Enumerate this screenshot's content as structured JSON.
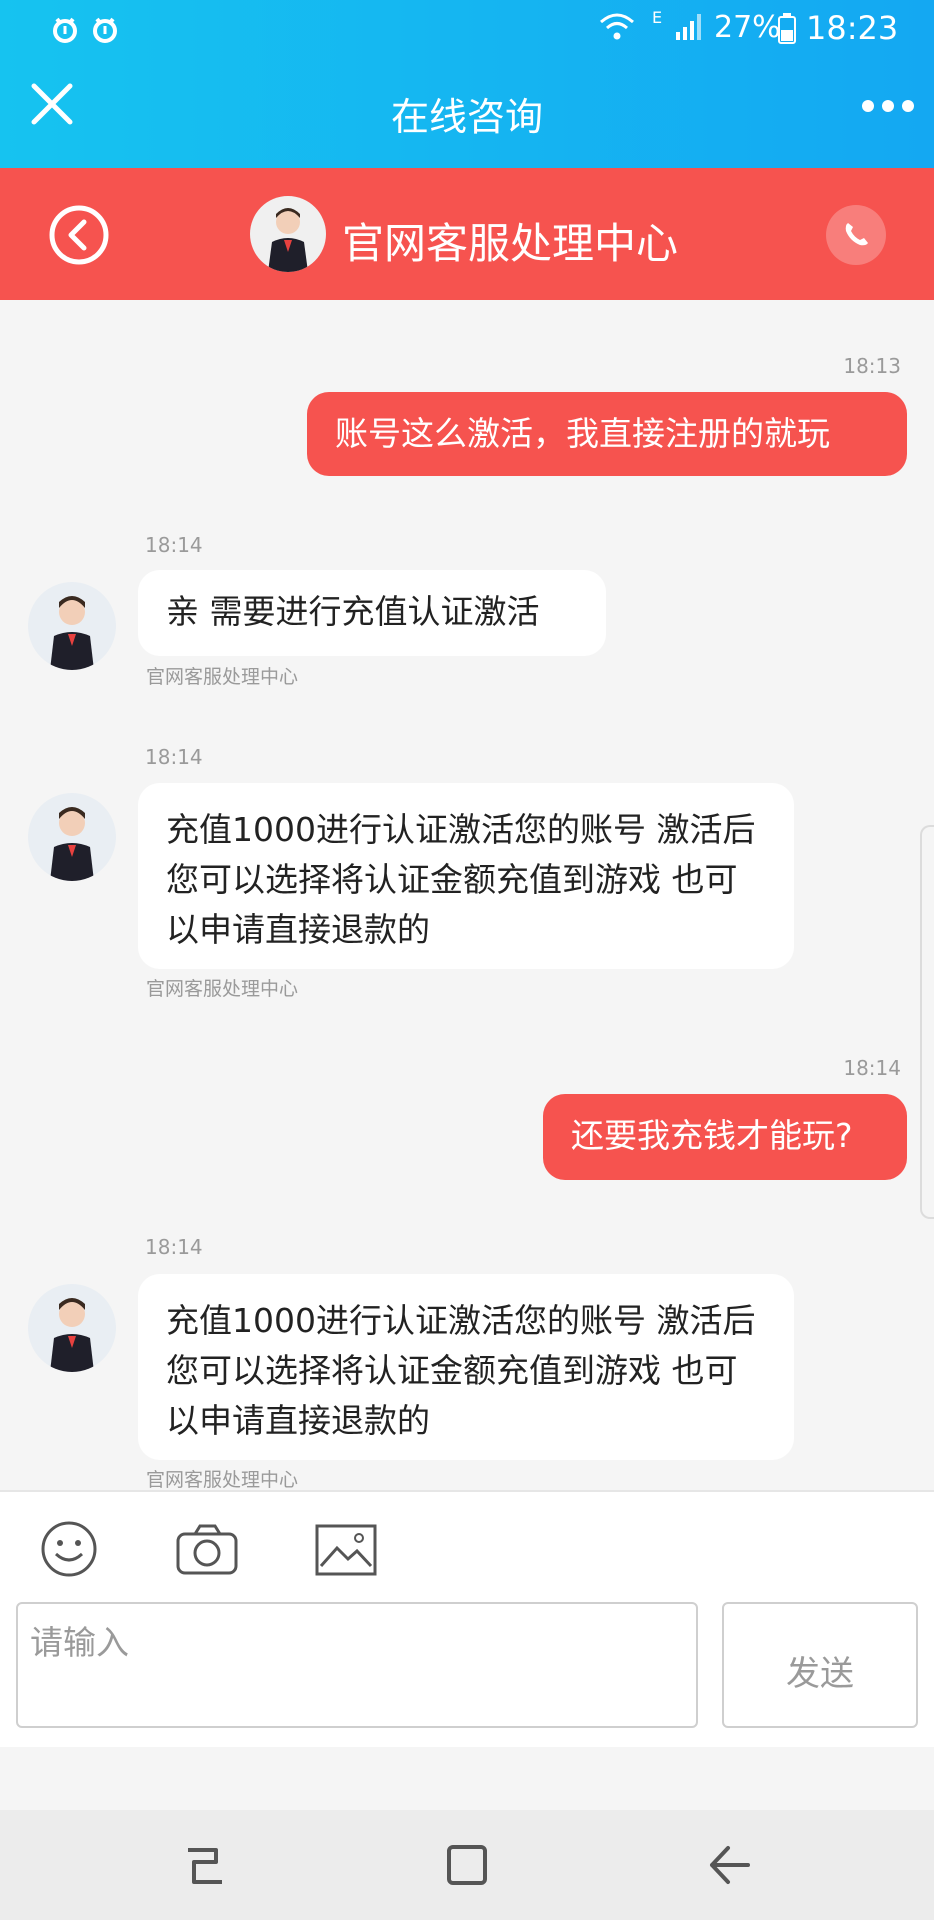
{
  "status": {
    "battery": "27%",
    "time": "18:23",
    "network": "E"
  },
  "titlebar": {
    "title": "在线咨询"
  },
  "agent_header": {
    "name": "官网客服处理中心"
  },
  "messages": [
    {
      "side": "out",
      "time": "18:13",
      "text": "账号这么激活，我直接注册的就玩"
    },
    {
      "side": "in",
      "time": "18:14",
      "text": "亲 需要进行充值认证激活",
      "sender": "官网客服处理中心"
    },
    {
      "side": "in",
      "time": "18:14",
      "text": "充值1000进行认证激活您的账号 激活后您可以选择将认证金额充值到游戏 也可以申请直接退款的",
      "sender": "官网客服处理中心"
    },
    {
      "side": "out",
      "time": "18:14",
      "text": "还要我充钱才能玩?"
    },
    {
      "side": "in",
      "time": "18:14",
      "text": "充值1000进行认证激活您的账号 激活后您可以选择将认证金额充值到游戏 也可以申请直接退款的",
      "sender": "官网客服处理中心"
    }
  ],
  "composer": {
    "placeholder": "请输入",
    "send_label": "发送"
  },
  "icons": {
    "close": "close-icon",
    "more": "more-icon",
    "back": "back-circle-icon",
    "phone": "phone-icon",
    "emoji": "emoji-icon",
    "camera": "camera-icon",
    "image": "image-icon",
    "nav_recent": "recent-apps-icon",
    "nav_home": "home-icon",
    "nav_back": "back-arrow-icon"
  },
  "colors": {
    "header_blue": "#16b5f2",
    "accent_red": "#f6534f"
  }
}
